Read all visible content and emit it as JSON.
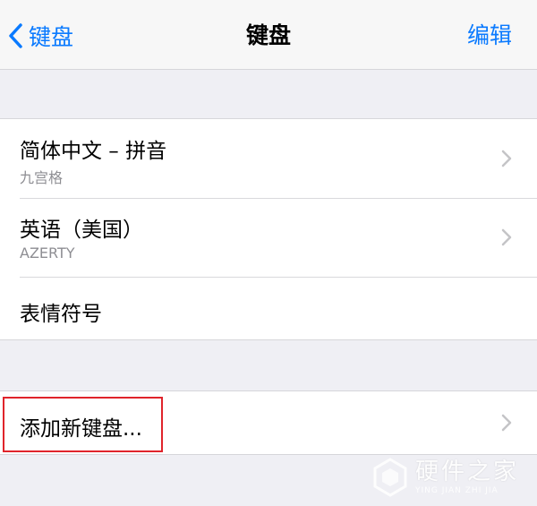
{
  "navbar": {
    "back_label": "键盘",
    "title": "键盘",
    "edit_label": "编辑"
  },
  "keyboards": [
    {
      "title": "简体中文 – 拼音",
      "subtitle": "九宫格"
    },
    {
      "title": "英语（美国）",
      "subtitle": "AZERTY"
    },
    {
      "title": "表情符号"
    }
  ],
  "add_keyboard": {
    "label": "添加新键盘..."
  },
  "watermark": {
    "text": "硬件之家",
    "subtext": "YING JIAN ZHI JIA"
  },
  "colors": {
    "accent": "#0a7aff",
    "background": "#efeff4",
    "highlight_border": "#e0242b"
  }
}
